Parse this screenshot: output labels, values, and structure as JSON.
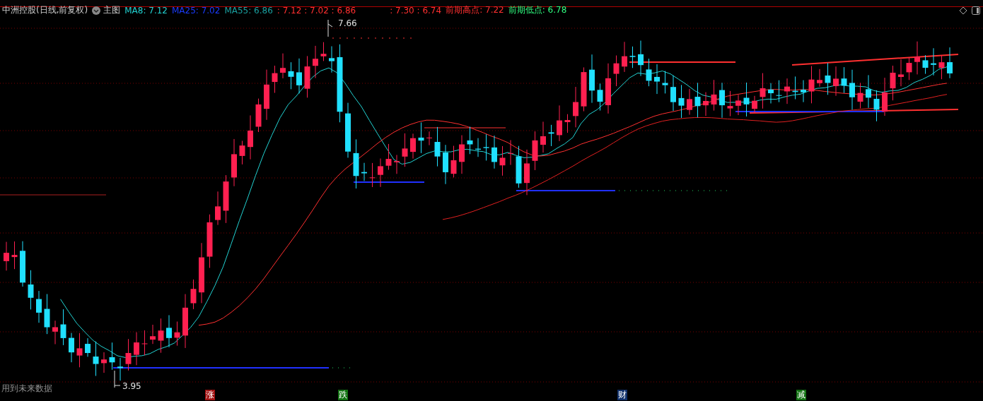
{
  "header": {
    "title": "中洲控股(日线,前复权)",
    "toggle": "主图"
  },
  "legend": [
    {
      "text": "MA8: 7.12",
      "color": "#22d3d3"
    },
    {
      "text": "MA25: 7.02",
      "color": "#1a3cff"
    },
    {
      "text": "MA55: 6.86",
      "color": "#1aa0a0"
    },
    {
      "text": ": 7.12 : 7.02 : 6.86",
      "color": "#ff3030"
    },
    {
      "text": ": 7.30 : 6.74",
      "color": "#ff3030"
    },
    {
      "text": "前期高点: 7.22",
      "color": "#ff3030"
    },
    {
      "text": "前期低点: 6.78",
      "color": "#30ff80"
    }
  ],
  "annotations": {
    "high": "7.66",
    "low": "3.95"
  },
  "notice": "用到未来数据",
  "markers": [
    {
      "text": "涨",
      "color": "#a01010"
    },
    {
      "text": "跌",
      "color": "#107010"
    },
    {
      "text": "财",
      "color": "#10306a"
    },
    {
      "text": "减",
      "color": "#107010"
    }
  ]
}
